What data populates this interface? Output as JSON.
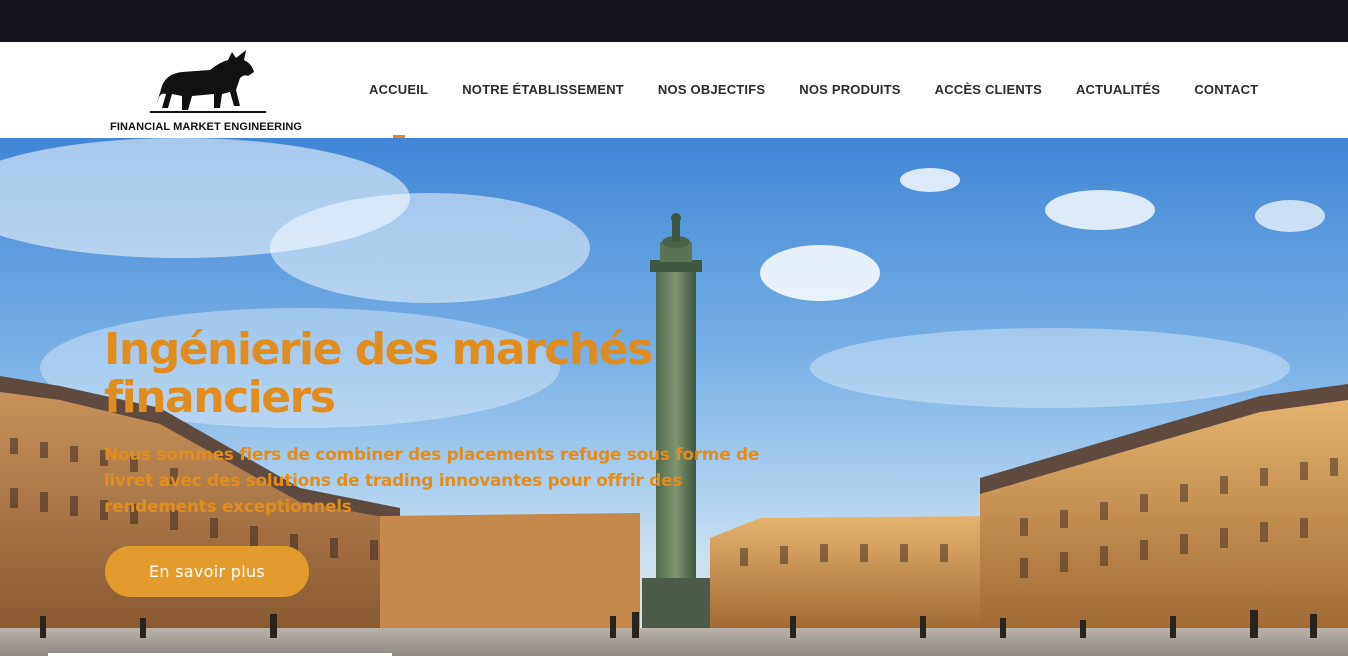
{
  "brand": {
    "logo_text": "FINANCIAL MARKET ENGINEERING"
  },
  "nav": {
    "items": [
      {
        "label": "ACCUEIL",
        "active": true
      },
      {
        "label": "NOTRE ÉTABLISSEMENT",
        "active": false
      },
      {
        "label": "NOS OBJECTIFS",
        "active": false
      },
      {
        "label": "NOS PRODUITS",
        "active": false
      },
      {
        "label": "ACCÈS CLIENTS",
        "active": false
      },
      {
        "label": "ACTUALITÉS",
        "active": false
      },
      {
        "label": "CONTACT",
        "active": false
      }
    ]
  },
  "hero": {
    "title": "Ingénierie des marchés financiers",
    "text": "Nous sommes fiers de combiner des placements refuge sous forme de livret avec des solutions de trading innovantes pour offrir des rendements exceptionnels",
    "button_label": "En savoir plus",
    "image": "place-vendome-column-photo"
  },
  "colors": {
    "topbar": "#15141f",
    "accent": "#e18d1e",
    "button": "#e39b2e",
    "nav_text": "#2b2b2b",
    "nav_active_underline": "#e5842c"
  },
  "icons": {
    "logo": "bull-icon"
  }
}
